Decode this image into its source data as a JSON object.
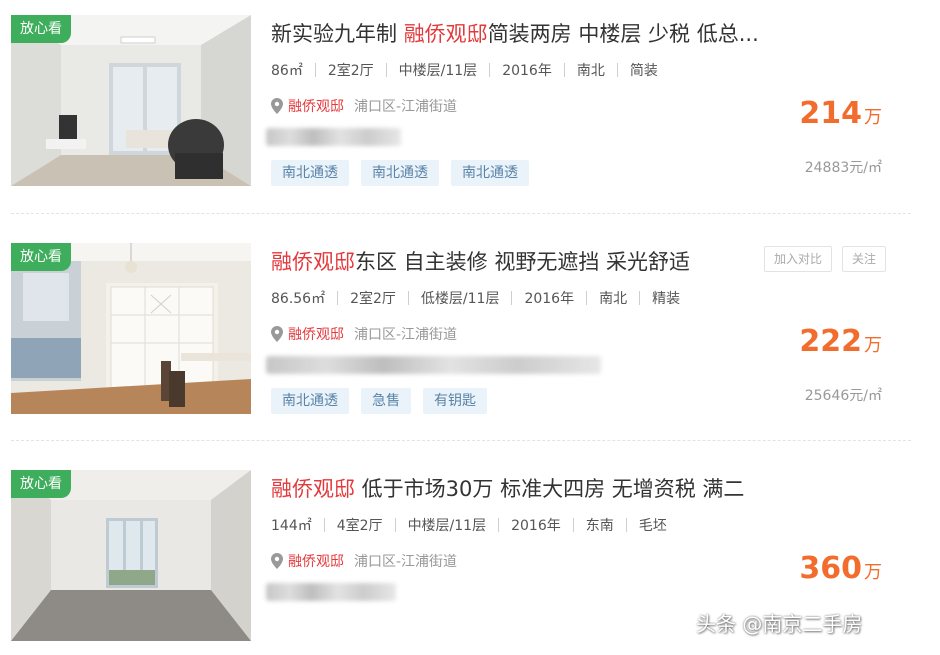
{
  "listings": [
    {
      "badge": "放心看",
      "title_pre": "新实验九年制 ",
      "title_highlight": "融侨观邸",
      "title_post": "简装两房 中楼层 少税 低总...",
      "area": "86㎡",
      "layout": "2室2厅",
      "floor": "中楼层/11层",
      "year": "2016年",
      "orientation": "南北",
      "decoration": "简装",
      "community": "融侨观邸",
      "district": "浦口区-江浦街道",
      "tags": [
        "南北通透",
        "南北通透",
        "南北通透"
      ],
      "price": "214",
      "price_unit": "万",
      "unit_price": "24883元/㎡"
    },
    {
      "badge": "放心看",
      "title_pre": "",
      "title_highlight": "融侨观邸",
      "title_post": "东区 自主装修 视野无遮挡 采光舒适",
      "area": "86.56㎡",
      "layout": "2室2厅",
      "floor": "低楼层/11层",
      "year": "2016年",
      "orientation": "南北",
      "decoration": "精装",
      "community": "融侨观邸",
      "district": "浦口区-江浦街道",
      "tags": [
        "南北通透",
        "急售",
        "有钥匙"
      ],
      "price": "222",
      "price_unit": "万",
      "unit_price": "25646元/㎡",
      "compare_label": "加入对比",
      "follow_label": "关注"
    },
    {
      "badge": "放心看",
      "title_pre": "",
      "title_highlight": "融侨观邸",
      "title_post": " 低于市场30万 标准大四房 无增资税 满二",
      "area": "144㎡",
      "layout": "4室2厅",
      "floor": "中楼层/11层",
      "year": "2016年",
      "orientation": "东南",
      "decoration": "毛坯",
      "community": "融侨观邸",
      "district": "浦口区-江浦街道",
      "tags": [],
      "price": "360",
      "price_unit": "万"
    }
  ],
  "watermark": "头条 @南京二手房",
  "colors": {
    "badge": "#3ead5c",
    "price": "#f26d2d",
    "highlight": "#e4393c",
    "tag_bg": "#eaf3fa",
    "tag_text": "#5a83a8"
  },
  "icons": [
    "location-pin-icon"
  ]
}
